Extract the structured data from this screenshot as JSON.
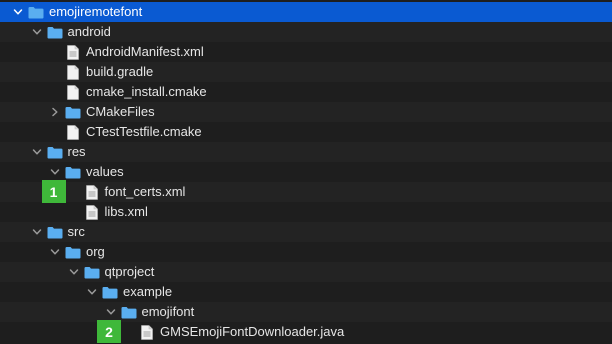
{
  "tree": {
    "rows": [
      {
        "label": "emojiremotefont",
        "type": "folder",
        "expanded": true,
        "indent": 0,
        "selected": true
      },
      {
        "label": "android",
        "type": "folder",
        "expanded": true,
        "indent": 1
      },
      {
        "label": "AndroidManifest.xml",
        "type": "file",
        "indent": 2,
        "doc": true
      },
      {
        "label": "build.gradle",
        "type": "file",
        "indent": 2
      },
      {
        "label": "cmake_install.cmake",
        "type": "file",
        "indent": 2
      },
      {
        "label": "CMakeFiles",
        "type": "folder",
        "expanded": false,
        "indent": 2
      },
      {
        "label": "CTestTestfile.cmake",
        "type": "file",
        "indent": 2
      },
      {
        "label": "res",
        "type": "folder",
        "expanded": true,
        "indent": 1
      },
      {
        "label": "values",
        "type": "folder",
        "expanded": true,
        "indent": 2
      },
      {
        "label": "font_certs.xml",
        "type": "file",
        "indent": 3,
        "doc": true
      },
      {
        "label": "libs.xml",
        "type": "file",
        "indent": 3,
        "doc": true
      },
      {
        "label": "src",
        "type": "folder",
        "expanded": true,
        "indent": 1
      },
      {
        "label": "org",
        "type": "folder",
        "expanded": true,
        "indent": 2
      },
      {
        "label": "qtproject",
        "type": "folder",
        "expanded": true,
        "indent": 3
      },
      {
        "label": "example",
        "type": "folder",
        "expanded": true,
        "indent": 4
      },
      {
        "label": "emojifont",
        "type": "folder",
        "expanded": true,
        "indent": 5
      },
      {
        "label": "GMSEmojiFontDownloader.java",
        "type": "file",
        "indent": 6,
        "doc": true
      }
    ]
  },
  "badges": [
    {
      "label": "1",
      "row": 9
    },
    {
      "label": "2",
      "row": 16
    }
  ],
  "colors": {
    "folder": "#5aaef0",
    "selection": "#0a5ad2",
    "badge": "#3fb83a"
  }
}
